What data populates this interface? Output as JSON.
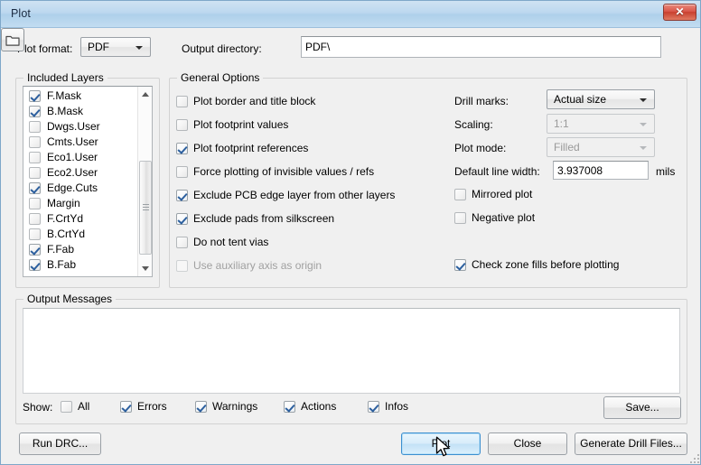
{
  "window": {
    "title": "Plot",
    "close_icon": "close-icon"
  },
  "top": {
    "plot_format_label": "Plot format:",
    "plot_format_value": "PDF",
    "output_directory_label": "Output directory:",
    "output_directory_value": "PDF\\",
    "output_directory_placeholder": "",
    "browse_icon": "folder-icon"
  },
  "included_layers": {
    "title": "Included Layers",
    "layers": [
      {
        "label": "F.Mask",
        "checked": true
      },
      {
        "label": "B.Mask",
        "checked": true
      },
      {
        "label": "Dwgs.User",
        "checked": false
      },
      {
        "label": "Cmts.User",
        "checked": false
      },
      {
        "label": "Eco1.User",
        "checked": false
      },
      {
        "label": "Eco2.User",
        "checked": false
      },
      {
        "label": "Edge.Cuts",
        "checked": true
      },
      {
        "label": "Margin",
        "checked": false
      },
      {
        "label": "F.CrtYd",
        "checked": false
      },
      {
        "label": "B.CrtYd",
        "checked": false
      },
      {
        "label": "F.Fab",
        "checked": true
      },
      {
        "label": "B.Fab",
        "checked": true
      }
    ]
  },
  "general_options": {
    "title": "General Options",
    "checkboxes": [
      {
        "label": "Plot border and title block",
        "checked": false,
        "disabled": false
      },
      {
        "label": "Plot footprint values",
        "checked": false,
        "disabled": false
      },
      {
        "label": "Plot footprint references",
        "checked": true,
        "disabled": false
      },
      {
        "label": "Force plotting of invisible values / refs",
        "checked": false,
        "disabled": false
      },
      {
        "label": "Exclude PCB edge layer from other layers",
        "checked": true,
        "disabled": false
      },
      {
        "label": "Exclude pads from silkscreen",
        "checked": true,
        "disabled": false
      },
      {
        "label": "Do not tent vias",
        "checked": false,
        "disabled": false
      },
      {
        "label": "Use auxiliary axis as origin",
        "checked": false,
        "disabled": true
      }
    ],
    "drill_marks_label": "Drill marks:",
    "drill_marks_value": "Actual size",
    "scaling_label": "Scaling:",
    "scaling_value": "1:1",
    "plot_mode_label": "Plot mode:",
    "plot_mode_value": "Filled",
    "line_width_label": "Default line width:",
    "line_width_value": "3.937008",
    "line_width_units": "mils",
    "right_checkboxes": [
      {
        "label": "Mirrored plot",
        "checked": false
      },
      {
        "label": "Negative plot",
        "checked": false
      }
    ],
    "check_zone_fills_label": "Check zone fills before plotting",
    "check_zone_fills_checked": true
  },
  "output_messages": {
    "title": "Output Messages",
    "content": "",
    "show_label": "Show:",
    "filters": [
      {
        "label": "All",
        "checked": false
      },
      {
        "label": "Errors",
        "checked": true
      },
      {
        "label": "Warnings",
        "checked": true
      },
      {
        "label": "Actions",
        "checked": true
      },
      {
        "label": "Infos",
        "checked": true
      }
    ],
    "save_label": "Save..."
  },
  "footer": {
    "run_drc_label": "Run DRC...",
    "plot_label": "Plot",
    "close_label": "Close",
    "generate_drill_label": "Generate Drill Files..."
  },
  "colors": {
    "titlebar_start": "#cfe2f2",
    "titlebar_end": "#c2dcf1",
    "dialog_bg": "#f0f0f0",
    "focus_blue": "#3c8fd0",
    "check_blue": "#2c5f9e",
    "close_red": "#d9574a"
  }
}
